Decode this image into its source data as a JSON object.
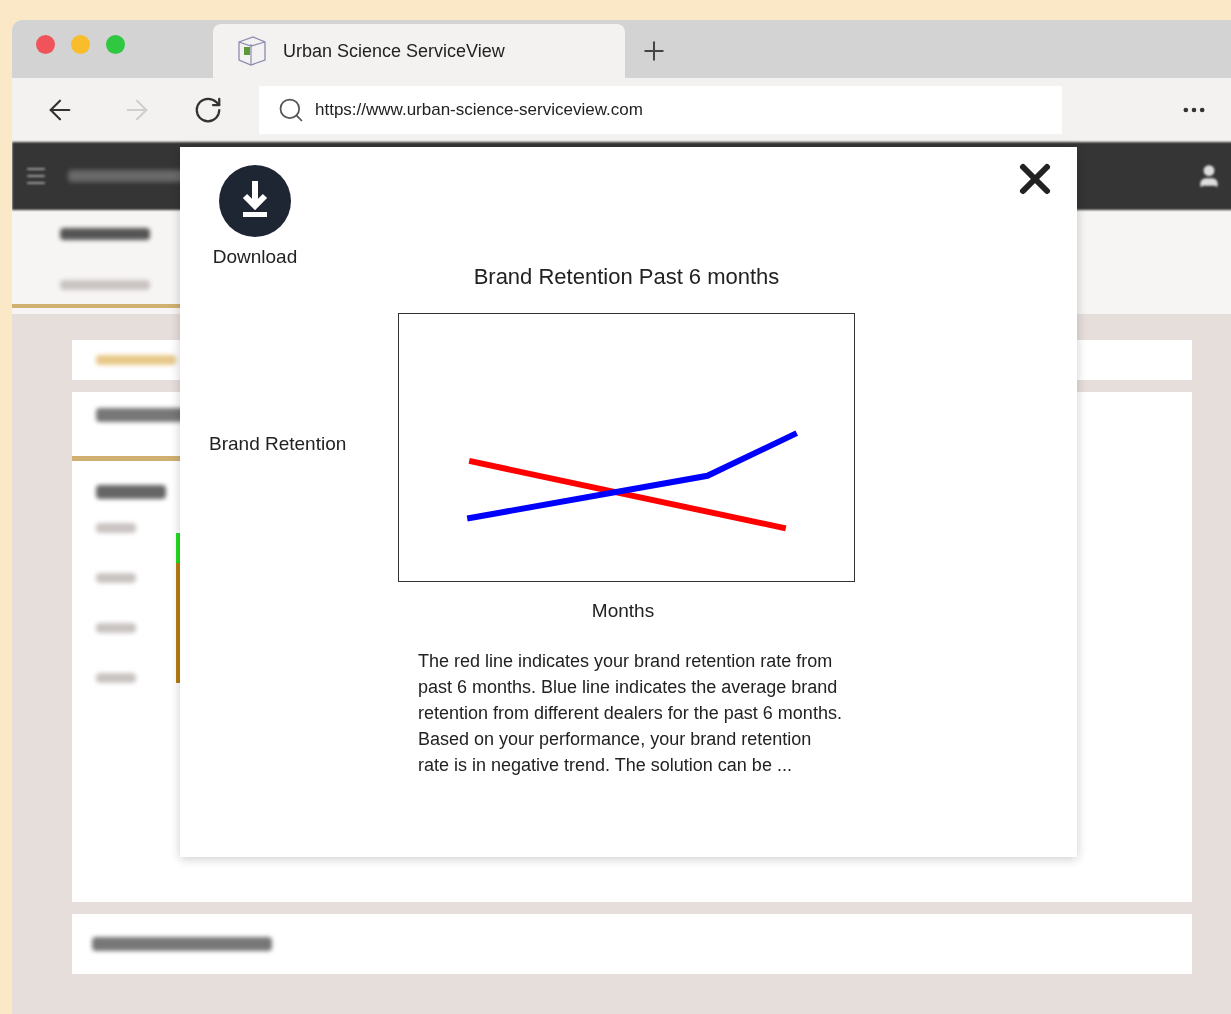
{
  "browser": {
    "tab_title": "Urban Science ServiceView",
    "url": "https://www.urban-science-serviceview.com",
    "forward_disabled": true
  },
  "modal": {
    "download_label": "Download",
    "chart": {
      "title": "Brand Retention Past 6 months",
      "ylabel": "Brand Retention",
      "xlabel": "Months",
      "lines": [
        {
          "color": "#ff0000"
        },
        {
          "color": "#0000ff"
        }
      ]
    },
    "description": "The red line indicates your brand retention rate from past 6 months. Blue line indicates the average brand retention from different dealers for the past 6 months. Based on your performance, your brand retention rate is in negative trend. The solution can be ..."
  }
}
